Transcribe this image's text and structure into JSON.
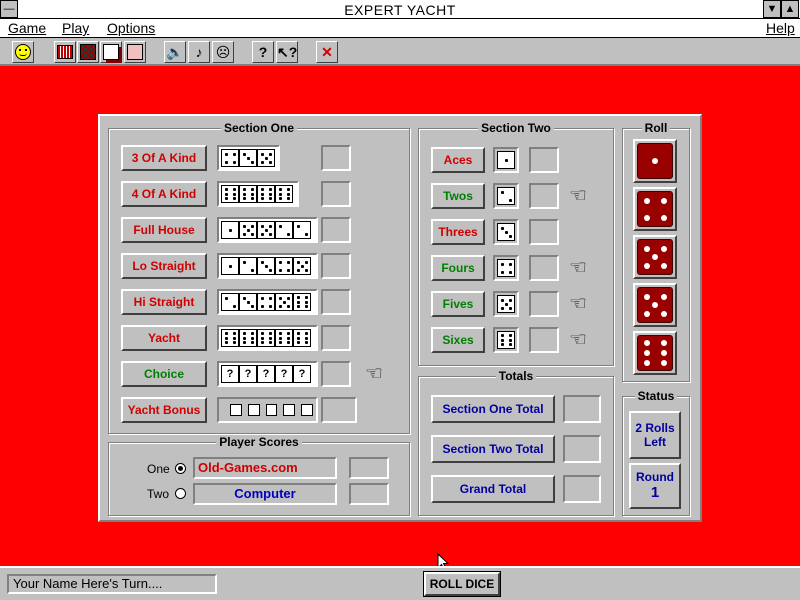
{
  "window": {
    "title": "EXPERT YACHT",
    "sys_menu": "—",
    "scroll_down": "▼",
    "scroll_up": "▲"
  },
  "menu": {
    "game": "Game",
    "play": "Play",
    "options": "Options",
    "help": "Help"
  },
  "toolbar": {
    "icons": [
      "smiley-icon",
      "abacus-icon",
      "checker-icon",
      "cards-icon",
      "photo-icon",
      "speaker-icon",
      "music-note-icon",
      "face-sad-icon",
      "help-icon",
      "context-help-icon",
      "close-x-icon"
    ],
    "help_glyph": "?",
    "close_glyph": "✕"
  },
  "section_one": {
    "title": "Section One",
    "rows": [
      {
        "label": "3 Of A Kind",
        "color": "red",
        "dice": [
          4,
          3,
          5
        ],
        "hand": false
      },
      {
        "label": "4 Of A Kind",
        "color": "red",
        "dice": [
          6,
          6,
          6,
          6
        ],
        "hand": false
      },
      {
        "label": "Full House",
        "color": "red",
        "dice": [
          1,
          5,
          5,
          2,
          2
        ],
        "hand": false
      },
      {
        "label": "Lo Straight",
        "color": "red",
        "dice": [
          1,
          2,
          3,
          4,
          5
        ],
        "hand": false
      },
      {
        "label": "Hi Straight",
        "color": "red",
        "dice": [
          2,
          3,
          4,
          5,
          6
        ],
        "hand": false
      },
      {
        "label": "Yacht",
        "color": "red",
        "dice": [
          6,
          6,
          6,
          6,
          6
        ],
        "hand": false
      },
      {
        "label": "Choice",
        "color": "green",
        "dice": [
          "?",
          "?",
          "?",
          "?",
          "?"
        ],
        "hand": true
      },
      {
        "label": "Yacht Bonus",
        "color": "red",
        "dice": [
          "",
          "",
          "",
          "",
          ""
        ],
        "hand": false
      }
    ]
  },
  "section_two": {
    "title": "Section Two",
    "rows": [
      {
        "label": "Aces",
        "color": "red",
        "die": 1,
        "hand": false
      },
      {
        "label": "Twos",
        "color": "green",
        "die": 2,
        "hand": true
      },
      {
        "label": "Threes",
        "color": "red",
        "die": 3,
        "hand": false
      },
      {
        "label": "Fours",
        "color": "green",
        "die": 4,
        "hand": true
      },
      {
        "label": "Fives",
        "color": "green",
        "die": 5,
        "hand": true
      },
      {
        "label": "Sixes",
        "color": "green",
        "die": 6,
        "hand": true
      }
    ]
  },
  "roll": {
    "title": "Roll",
    "dice": [
      1,
      4,
      5,
      5,
      6
    ]
  },
  "totals": {
    "title": "Totals",
    "items": [
      "Section One Total",
      "Section Two Total",
      "Grand Total"
    ]
  },
  "status": {
    "title": "Status",
    "rolls_left_line1": "2 Rolls",
    "rolls_left_line2": "Left",
    "round_label": "Round",
    "round_value": "1"
  },
  "players": {
    "title": "Player Scores",
    "one_label": "One",
    "two_label": "Two",
    "one_name": "Old-Games.com",
    "two_name": "Computer",
    "selected": "One"
  },
  "statusbar": {
    "turn_text": "Your Name Here's Turn....",
    "roll_button": "ROLL DICE"
  },
  "colors": {
    "background": "#ff0000",
    "panel": "#c0c0c0",
    "roll_die": "#990000",
    "label_red": "#d00000",
    "label_green": "#008000",
    "label_blue": "#0000a0"
  }
}
